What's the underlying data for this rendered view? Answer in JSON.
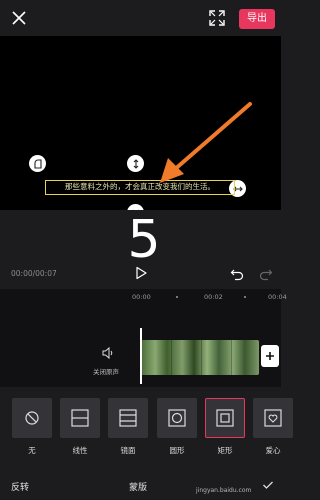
{
  "header": {
    "export_label": "导出",
    "icons": [
      "close-icon",
      "fullscreen-icon"
    ]
  },
  "preview": {
    "subtitle_text": "那些意料之外的，才会真正改变我们的生活。",
    "annotation_arrow_color": "#f07b2a",
    "subtitle_box_color": "#e8d34a",
    "icons": [
      "rotate-corner-icon",
      "vertical-resize-icon",
      "horizontal-resize-icon",
      "feather-icon"
    ]
  },
  "player": {
    "overlay_number": "5",
    "time_readout": "00:00/00:07",
    "icons": [
      "play-icon",
      "undo-icon",
      "redo-icon"
    ]
  },
  "timeline": {
    "ruler": [
      "00:00",
      "00:02",
      "00:04"
    ],
    "mute_label": "关闭原声",
    "icons": [
      "speaker-icon",
      "plus-icon"
    ]
  },
  "mask_options": [
    {
      "label": "无",
      "icon": "none-icon"
    },
    {
      "label": "线性",
      "icon": "linear-mask-icon"
    },
    {
      "label": "镜面",
      "icon": "mirror-mask-icon"
    },
    {
      "label": "圆形",
      "icon": "circle-mask-icon"
    },
    {
      "label": "矩形",
      "icon": "rectangle-mask-icon",
      "selected": true
    },
    {
      "label": "爱心",
      "icon": "heart-mask-icon"
    }
  ],
  "bottom_bar": {
    "invert_label": "反转",
    "title": "蒙版",
    "watermark": "jingyan.baidu.com",
    "icons": [
      "checkmark-icon"
    ]
  },
  "colors": {
    "accent": "#e8375e",
    "background": "#1c1c1e",
    "preview_background": "#000000"
  }
}
